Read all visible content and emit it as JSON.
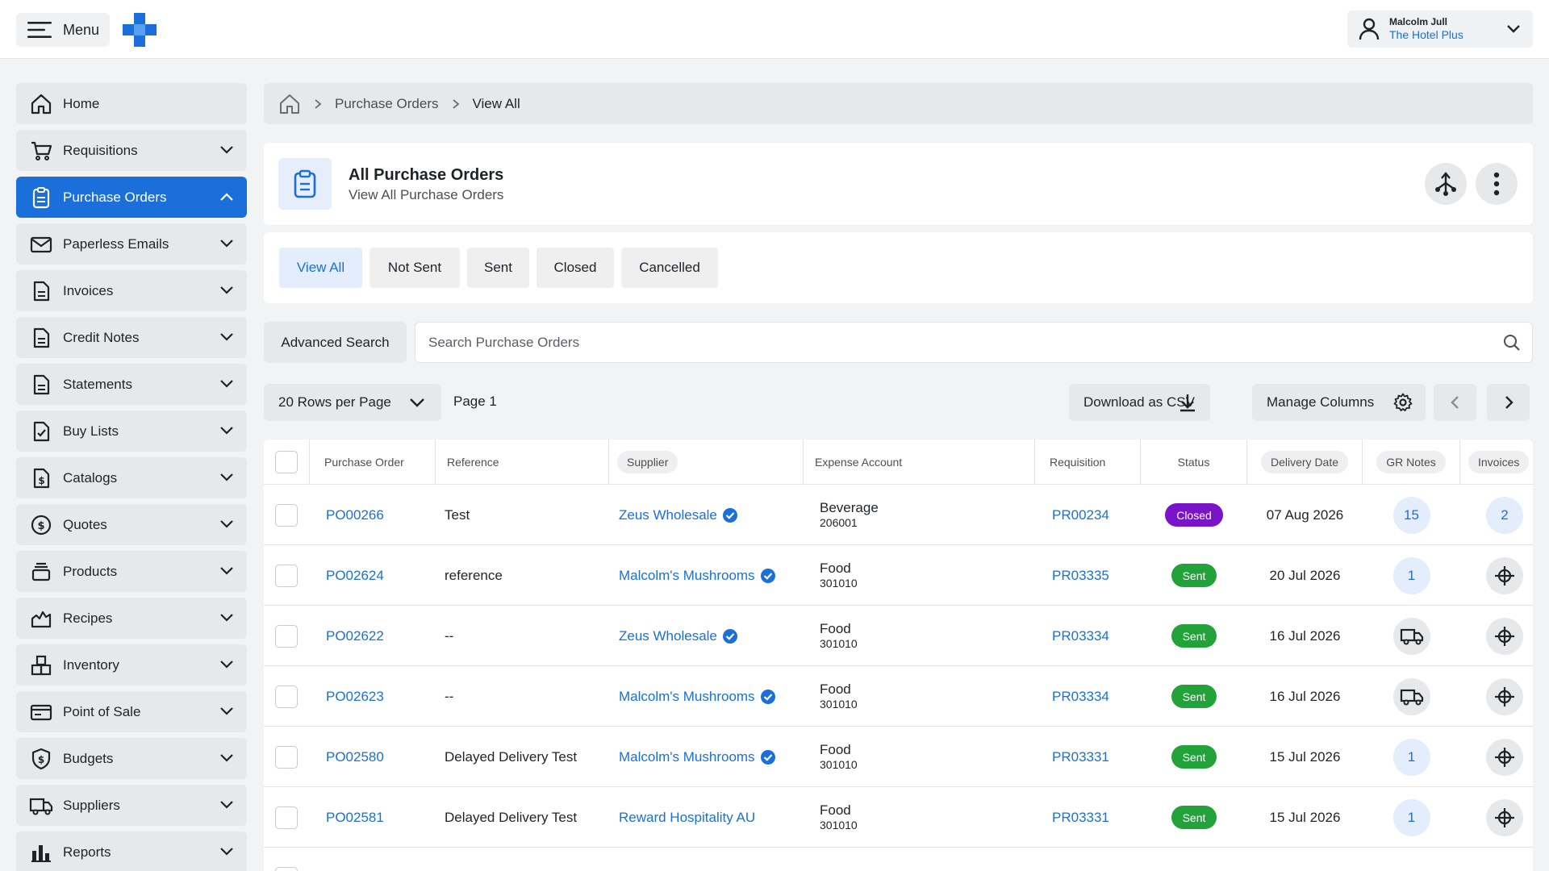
{
  "topbar": {
    "menu_label": "Menu",
    "user_name": "Malcolm Jull",
    "user_org": "The Hotel Plus"
  },
  "sidebar": {
    "items": [
      {
        "label": "Home",
        "icon": "home-icon"
      },
      {
        "label": "Requisitions",
        "icon": "cart-icon"
      },
      {
        "label": "Purchase Orders",
        "icon": "clipboard-icon",
        "active": true
      },
      {
        "label": "Paperless Emails",
        "icon": "envelope-icon"
      },
      {
        "label": "Invoices",
        "icon": "document-icon"
      },
      {
        "label": "Credit Notes",
        "icon": "document-icon"
      },
      {
        "label": "Statements",
        "icon": "document-icon"
      },
      {
        "label": "Buy Lists",
        "icon": "checklist-icon"
      },
      {
        "label": "Catalogs",
        "icon": "dollar-document-icon"
      },
      {
        "label": "Quotes",
        "icon": "dollar-circle-icon"
      },
      {
        "label": "Products",
        "icon": "stack-icon"
      },
      {
        "label": "Recipes",
        "icon": "chef-hat-icon"
      },
      {
        "label": "Inventory",
        "icon": "boxes-icon"
      },
      {
        "label": "Point of Sale",
        "icon": "card-icon"
      },
      {
        "label": "Budgets",
        "icon": "shield-dollar-icon"
      },
      {
        "label": "Suppliers",
        "icon": "truck-icon"
      },
      {
        "label": "Reports",
        "icon": "bar-chart-icon"
      }
    ]
  },
  "breadcrumb": {
    "section": "Purchase Orders",
    "current": "View All"
  },
  "header": {
    "title": "All Purchase Orders",
    "subtitle": "View All Purchase Orders"
  },
  "tabs": [
    "View All",
    "Not Sent",
    "Sent",
    "Closed",
    "Cancelled"
  ],
  "search": {
    "advanced_label": "Advanced Search",
    "placeholder": "Search Purchase Orders"
  },
  "toolbar": {
    "rows_per_page": "20 Rows per Page",
    "page_label": "Page 1",
    "download_label": "Download as CSV",
    "manage_columns_label": "Manage Columns"
  },
  "table": {
    "columns": [
      "Purchase Order",
      "Reference",
      "Supplier",
      "Expense Account",
      "Requisition",
      "Status",
      "Delivery Date",
      "GR Notes",
      "Invoices"
    ],
    "rows": [
      {
        "po": "PO00266",
        "reference": "Test",
        "supplier": "Zeus Wholesale",
        "verified": true,
        "account": "Beverage",
        "account_code": "206001",
        "requisition": "PR00234",
        "status": "Closed",
        "delivery": "07 Aug 2026",
        "gr_notes": "15",
        "invoices": "2"
      },
      {
        "po": "PO02624",
        "reference": "reference",
        "supplier": "Malcolm's Mushrooms",
        "verified": true,
        "account": "Food",
        "account_code": "301010",
        "requisition": "PR03335",
        "status": "Sent",
        "delivery": "20 Jul 2026",
        "gr_notes": "1",
        "invoices": ""
      },
      {
        "po": "PO02622",
        "reference": "--",
        "supplier": "Zeus Wholesale",
        "verified": true,
        "account": "Food",
        "account_code": "301010",
        "requisition": "PR03334",
        "status": "Sent",
        "delivery": "16 Jul 2026",
        "gr_notes": "",
        "invoices": ""
      },
      {
        "po": "PO02623",
        "reference": "--",
        "supplier": "Malcolm's Mushrooms",
        "verified": true,
        "account": "Food",
        "account_code": "301010",
        "requisition": "PR03334",
        "status": "Sent",
        "delivery": "16 Jul 2026",
        "gr_notes": "",
        "invoices": ""
      },
      {
        "po": "PO02580",
        "reference": "Delayed Delivery Test",
        "supplier": "Malcolm's Mushrooms",
        "verified": true,
        "account": "Food",
        "account_code": "301010",
        "requisition": "PR03331",
        "status": "Sent",
        "delivery": "15 Jul 2026",
        "gr_notes": "1",
        "invoices": ""
      },
      {
        "po": "PO02581",
        "reference": "Delayed Delivery Test",
        "supplier": "Reward Hospitality AU",
        "verified": false,
        "account": "Food",
        "account_code": "301010",
        "requisition": "PR03331",
        "status": "Sent",
        "delivery": "15 Jul 2026",
        "gr_notes": "1",
        "invoices": ""
      }
    ]
  },
  "colors": {
    "accent": "#1a6fdb",
    "closed": "#7a14c8",
    "sent": "#21a33a"
  }
}
